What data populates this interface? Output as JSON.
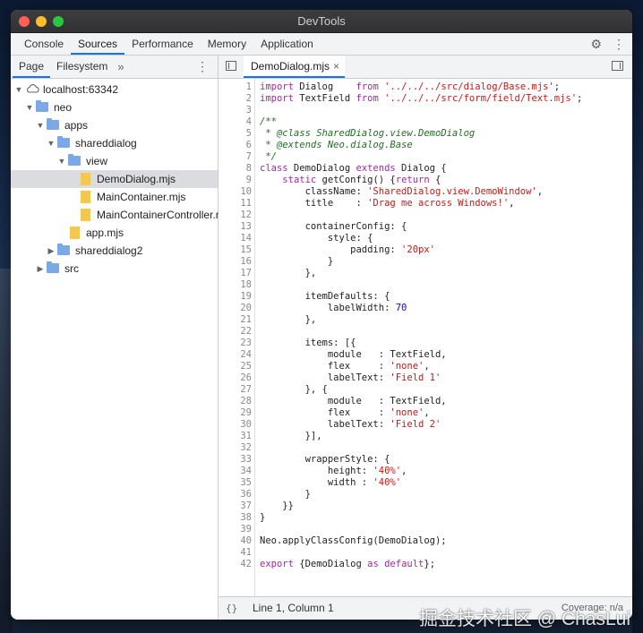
{
  "window": {
    "title": "DevTools"
  },
  "main_tabs": [
    {
      "label": "Console"
    },
    {
      "label": "Sources",
      "active": true
    },
    {
      "label": "Performance"
    },
    {
      "label": "Memory"
    },
    {
      "label": "Application"
    }
  ],
  "sidebar": {
    "tabs": [
      {
        "label": "Page",
        "active": true
      },
      {
        "label": "Filesystem"
      }
    ],
    "more": "»",
    "tree": [
      {
        "label": "localhost:63342",
        "type": "cloud",
        "depth": 0,
        "expanded": true
      },
      {
        "label": "neo",
        "type": "folder",
        "depth": 1,
        "expanded": true
      },
      {
        "label": "apps",
        "type": "folder",
        "depth": 2,
        "expanded": true
      },
      {
        "label": "shareddialog",
        "type": "folder",
        "depth": 3,
        "expanded": true
      },
      {
        "label": "view",
        "type": "folder",
        "depth": 4,
        "expanded": true
      },
      {
        "label": "DemoDialog.mjs",
        "type": "file",
        "depth": 5,
        "selected": true
      },
      {
        "label": "MainContainer.mjs",
        "type": "file",
        "depth": 5
      },
      {
        "label": "MainContainerController.mjs",
        "type": "file",
        "depth": 5
      },
      {
        "label": "app.mjs",
        "type": "file",
        "depth": 4
      },
      {
        "label": "shareddialog2",
        "type": "folder",
        "depth": 3,
        "expanded": false
      },
      {
        "label": "src",
        "type": "folder",
        "depth": 2,
        "expanded": false
      }
    ]
  },
  "editor": {
    "tab_label": "DemoDialog.mjs",
    "close_glyph": "×",
    "lines": [
      "import Dialog    from '../../../src/dialog/Base.mjs';",
      "import TextField from '../../../src/form/field/Text.mjs';",
      "",
      "/**",
      " * @class SharedDialog.view.DemoDialog",
      " * @extends Neo.dialog.Base",
      " */",
      "class DemoDialog extends Dialog {",
      "    static getConfig() {return {",
      "        className: 'SharedDialog.view.DemoWindow',",
      "        title    : 'Drag me across Windows!',",
      "",
      "        containerConfig: {",
      "            style: {",
      "                padding: '20px'",
      "            }",
      "        },",
      "",
      "        itemDefaults: {",
      "            labelWidth: 70",
      "        },",
      "",
      "        items: [{",
      "            module   : TextField,",
      "            flex     : 'none',",
      "            labelText: 'Field 1'",
      "        }, {",
      "            module   : TextField,",
      "            flex     : 'none',",
      "            labelText: 'Field 2'",
      "        }],",
      "",
      "        wrapperStyle: {",
      "            height: '40%',",
      "            width : '40%'",
      "        }",
      "    }}",
      "}",
      "",
      "Neo.applyClassConfig(DemoDialog);",
      "",
      "export {DemoDialog as default};"
    ]
  },
  "status": {
    "braces": "{}",
    "position": "Line 1, Column 1",
    "coverage": "Coverage: n/a"
  },
  "watermark": "掘金技术社区 @ ChasLui",
  "icons": [
    "gear-icon",
    "kebab-menu-icon",
    "cloud-icon",
    "folder-icon",
    "file-icon",
    "navigator-toggle-icon",
    "debugger-toggle-icon"
  ]
}
